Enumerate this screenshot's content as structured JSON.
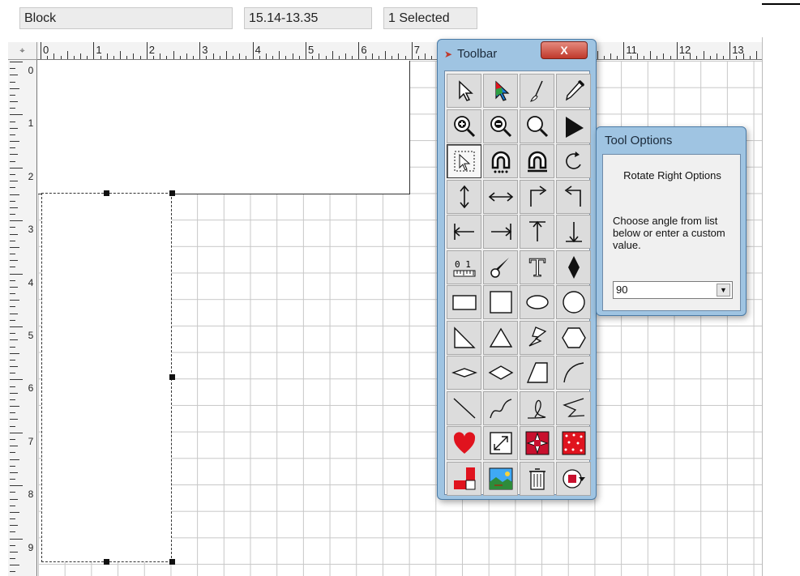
{
  "statusbar": {
    "mode": "Block",
    "coordinates": "15.14-13.35",
    "selection": "1 Selected"
  },
  "rulers": {
    "horizontal_labels": [
      "0",
      "1",
      "2",
      "3",
      "4",
      "5",
      "6",
      "7",
      "11",
      "12",
      "13"
    ],
    "vertical_labels": [
      "0",
      "1",
      "2",
      "3",
      "4",
      "5",
      "6",
      "7",
      "8",
      "9"
    ]
  },
  "toolbar": {
    "title": "Toolbar",
    "close_label": "X",
    "tools": [
      {
        "name": "select-arrow",
        "icon": "select-arrow-icon"
      },
      {
        "name": "color-select",
        "icon": "color-arrow-icon"
      },
      {
        "name": "brush",
        "icon": "brush-icon"
      },
      {
        "name": "eyedropper",
        "icon": "eyedropper-icon"
      },
      {
        "name": "zoom-in",
        "icon": "zoom-in-icon"
      },
      {
        "name": "zoom-out",
        "icon": "zoom-out-icon"
      },
      {
        "name": "zoom",
        "icon": "zoom-icon"
      },
      {
        "name": "pointer",
        "icon": "pointer-icon"
      },
      {
        "name": "select-box",
        "icon": "select-box-icon"
      },
      {
        "name": "magnet",
        "icon": "magnet-icon"
      },
      {
        "name": "magnet-alt",
        "icon": "magnet-alt-icon"
      },
      {
        "name": "rotate-right",
        "icon": "rotate-right-icon"
      },
      {
        "name": "flip-vertical",
        "icon": "vertical-arrows-icon"
      },
      {
        "name": "flip-horizontal",
        "icon": "horizontal-arrows-icon"
      },
      {
        "name": "turn-right",
        "icon": "turn-right-icon"
      },
      {
        "name": "turn-left",
        "icon": "turn-left-icon"
      },
      {
        "name": "align-left",
        "icon": "align-left-icon"
      },
      {
        "name": "align-right",
        "icon": "align-right-icon"
      },
      {
        "name": "align-top",
        "icon": "align-top-icon"
      },
      {
        "name": "align-bottom",
        "icon": "align-bottom-icon"
      },
      {
        "name": "measure",
        "icon": "ruler-icon",
        "text": "0 1"
      },
      {
        "name": "knife",
        "icon": "knife-icon"
      },
      {
        "name": "text",
        "icon": "text-icon",
        "text": "T"
      },
      {
        "name": "diamond-point",
        "icon": "diamond-icon"
      },
      {
        "name": "rectangle",
        "icon": "rectangle-icon"
      },
      {
        "name": "square",
        "icon": "square-icon"
      },
      {
        "name": "ellipse",
        "icon": "ellipse-icon"
      },
      {
        "name": "circle",
        "icon": "circle-icon"
      },
      {
        "name": "right-triangle",
        "icon": "right-triangle-icon"
      },
      {
        "name": "triangle",
        "icon": "triangle-icon"
      },
      {
        "name": "star-shape",
        "icon": "star-shape-icon"
      },
      {
        "name": "hexagon",
        "icon": "hexagon-icon"
      },
      {
        "name": "flat-diamond",
        "icon": "flat-diamond-icon"
      },
      {
        "name": "rhombus",
        "icon": "rhombus-icon"
      },
      {
        "name": "trapezoid",
        "icon": "trapezoid-icon"
      },
      {
        "name": "arc",
        "icon": "arc-icon"
      },
      {
        "name": "line",
        "icon": "line-icon"
      },
      {
        "name": "curve",
        "icon": "curve-icon"
      },
      {
        "name": "freehand",
        "icon": "freehand-icon"
      },
      {
        "name": "polyline",
        "icon": "polyline-icon"
      },
      {
        "name": "heart",
        "icon": "heart-icon"
      },
      {
        "name": "resize",
        "icon": "resize-icon"
      },
      {
        "name": "star-block",
        "icon": "star-block-icon"
      },
      {
        "name": "pattern-block",
        "icon": "pattern-block-icon"
      },
      {
        "name": "corner-block",
        "icon": "corner-block-icon"
      },
      {
        "name": "image",
        "icon": "image-icon"
      },
      {
        "name": "trash",
        "icon": "trash-icon"
      },
      {
        "name": "color-menu",
        "icon": "color-menu-icon"
      }
    ]
  },
  "tool_options": {
    "title": "Tool Options",
    "heading": "Rotate Right Options",
    "description": "Choose angle from list below or enter a custom value.",
    "angle_value": "90"
  },
  "colors": {
    "window_frame": "#9fc4e2",
    "close_button": "#c0392b",
    "heart": "#e0131e",
    "grid_line": "#c7c7c7"
  }
}
